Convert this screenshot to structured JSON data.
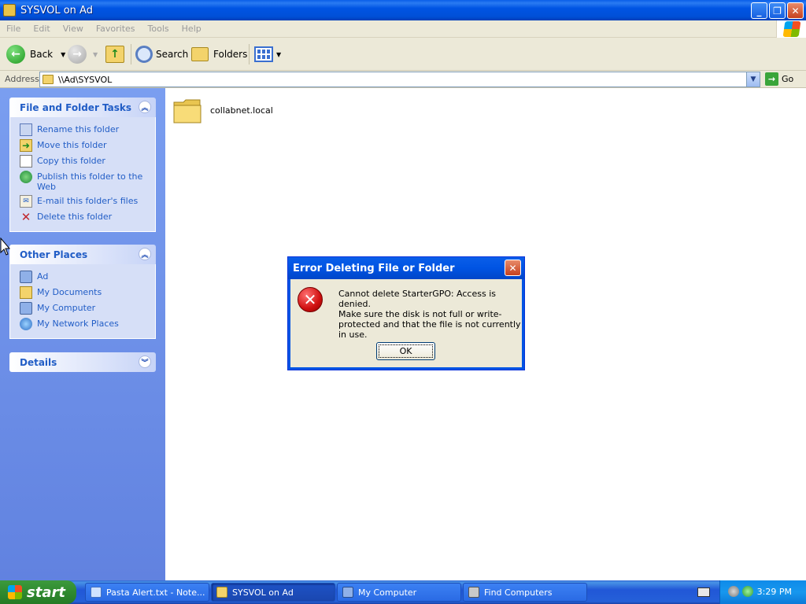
{
  "window": {
    "title": "SYSVOL on Ad"
  },
  "menu": [
    "File",
    "Edit",
    "View",
    "Favorites",
    "Tools",
    "Help"
  ],
  "toolbar": {
    "back_label": "Back",
    "search_label": "Search",
    "folders_label": "Folders"
  },
  "address": {
    "label": "Address",
    "value": "\\\\Ad\\SYSVOL",
    "go_label": "Go"
  },
  "taskpane": {
    "file_tasks": {
      "title": "File and Folder Tasks",
      "items": [
        {
          "label": "Rename this folder",
          "icon": "rename-icon"
        },
        {
          "label": "Move this folder",
          "icon": "move-icon"
        },
        {
          "label": "Copy this folder",
          "icon": "copy-icon"
        },
        {
          "label": "Publish this folder to the Web",
          "icon": "publish-icon"
        },
        {
          "label": "E-mail this folder's files",
          "icon": "email-icon"
        },
        {
          "label": "Delete this folder",
          "icon": "delete-icon"
        }
      ]
    },
    "other_places": {
      "title": "Other Places",
      "items": [
        {
          "label": "Ad",
          "icon": "computer-icon"
        },
        {
          "label": "My Documents",
          "icon": "documents-icon"
        },
        {
          "label": "My Computer",
          "icon": "computer-icon"
        },
        {
          "label": "My Network Places",
          "icon": "network-icon"
        }
      ]
    },
    "details": {
      "title": "Details"
    }
  },
  "content": {
    "folder_name": "collabnet.local"
  },
  "dialog": {
    "title": "Error Deleting File or Folder",
    "message": "Cannot delete StarterGPO: Access is denied.",
    "detail": "Make sure the disk is not full or write-protected and that the file is not currently in use.",
    "ok_label": "OK"
  },
  "taskbar": {
    "start_label": "start",
    "tasks": [
      {
        "label": "Pasta Alert.txt - Note...",
        "active": false
      },
      {
        "label": "SYSVOL on Ad",
        "active": true
      },
      {
        "label": "My Computer",
        "active": false
      },
      {
        "label": "Find Computers",
        "active": false
      }
    ],
    "clock": "3:29 PM"
  }
}
